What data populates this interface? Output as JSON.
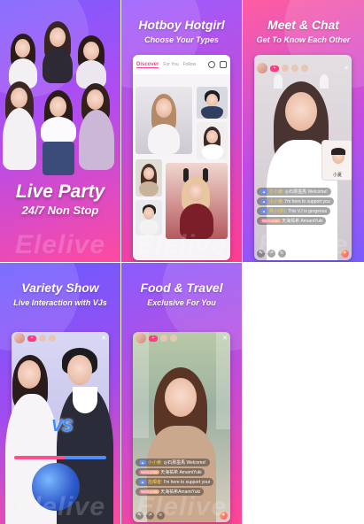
{
  "brand": {
    "watermark": "Elelive"
  },
  "panels": [
    {
      "id": "live-party",
      "title": "Live Party",
      "subtitle": "24/7 Non Stop"
    },
    {
      "id": "hotboy",
      "title": "Hotboy Hotgirl",
      "subtitle": "Choose Your Types",
      "tabs": [
        "Discover",
        "For You",
        "Follow"
      ]
    },
    {
      "id": "meet-chat",
      "title": "Meet & Chat",
      "subtitle": "Get To Know Each Other",
      "chat": [
        {
          "name": "小小姜:",
          "text": "◎石那墨馬 Welcome!"
        },
        {
          "name": "小小姜:",
          "text": "I'm here to support you"
        },
        {
          "name": "林小(你):",
          "text": "This VJ is gorgeous"
        },
        {
          "name": "Welcome",
          "text": "天海祐希 AmamiYuki"
        }
      ],
      "pip_label": "小夏"
    },
    {
      "id": "variety",
      "title": "Variety Show",
      "subtitle": "Live Interaction with VJs",
      "vs": "VS"
    },
    {
      "id": "food",
      "title": "Food & Travel",
      "subtitle": "Exclusive For You",
      "chat": [
        {
          "name": "小小姜:",
          "text": "◎石那墨馬 Welcome!"
        },
        {
          "name": "Welcome",
          "text": "天海祐希 AmamiYuki"
        },
        {
          "name": "焰燭者:",
          "text": "I'm here to support your"
        },
        {
          "name": "Welcome",
          "text": "天海祐希AmamiYuki"
        }
      ]
    }
  ],
  "colors": {
    "accent": "#ff3d8f",
    "purple": "#a04cf0"
  }
}
